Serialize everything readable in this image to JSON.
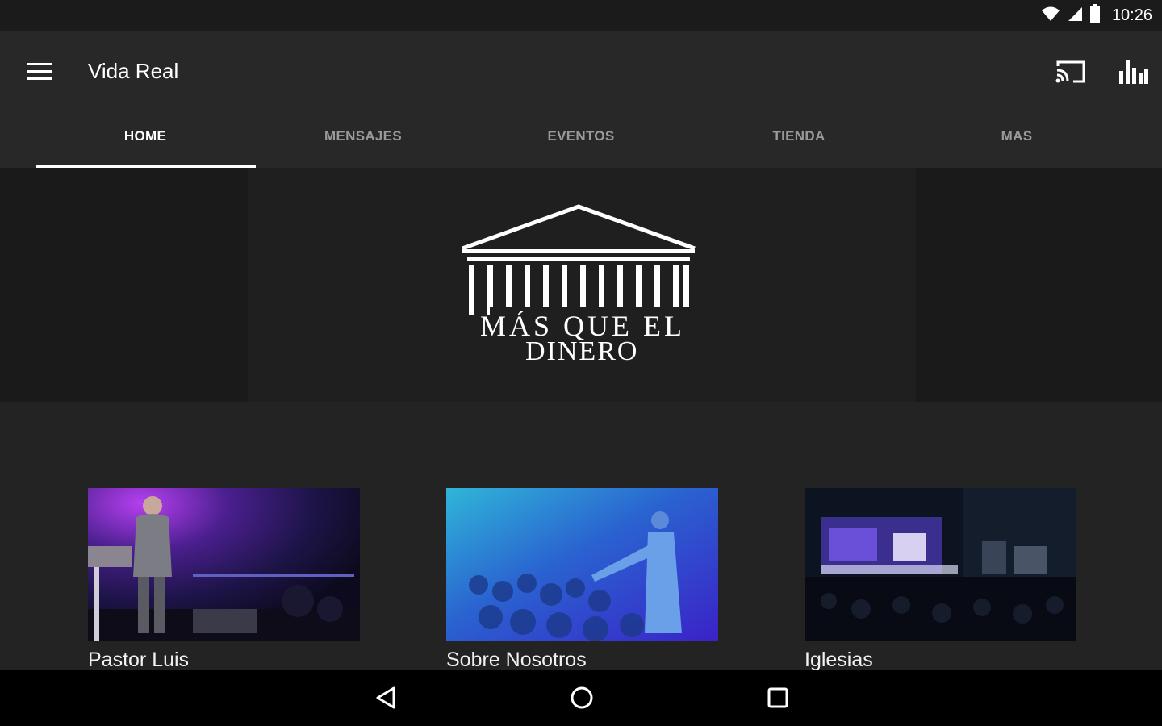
{
  "status_bar": {
    "time": "10:26",
    "icons": [
      "wifi-icon",
      "cell-signal-icon",
      "battery-icon"
    ]
  },
  "app_bar": {
    "title": "Vida Real",
    "icons": [
      "menu-icon",
      "cast-icon",
      "bar-chart-icon"
    ]
  },
  "tabs": [
    {
      "label": "HOME",
      "active": true
    },
    {
      "label": "MENSAJES",
      "active": false
    },
    {
      "label": "EVENTOS",
      "active": false
    },
    {
      "label": "TIENDA",
      "active": false
    },
    {
      "label": "MAS",
      "active": false
    }
  ],
  "banner": {
    "logo_text_line1": "MÁS QUE EL",
    "logo_text_line2": "DINERO"
  },
  "cards": [
    {
      "label": "Pastor Luis"
    },
    {
      "label": "Sobre Nosotros"
    },
    {
      "label": "Iglesias"
    }
  ],
  "nav_bar": {
    "icons": [
      "back-icon",
      "home-icon",
      "recents-icon"
    ]
  },
  "colors": {
    "background": "#212121",
    "app_bar": "#282828",
    "status_bar": "#1b1b1b",
    "tab_inactive": "#9a9a9a",
    "tab_active": "#ffffff",
    "nav_bar": "#000000"
  }
}
